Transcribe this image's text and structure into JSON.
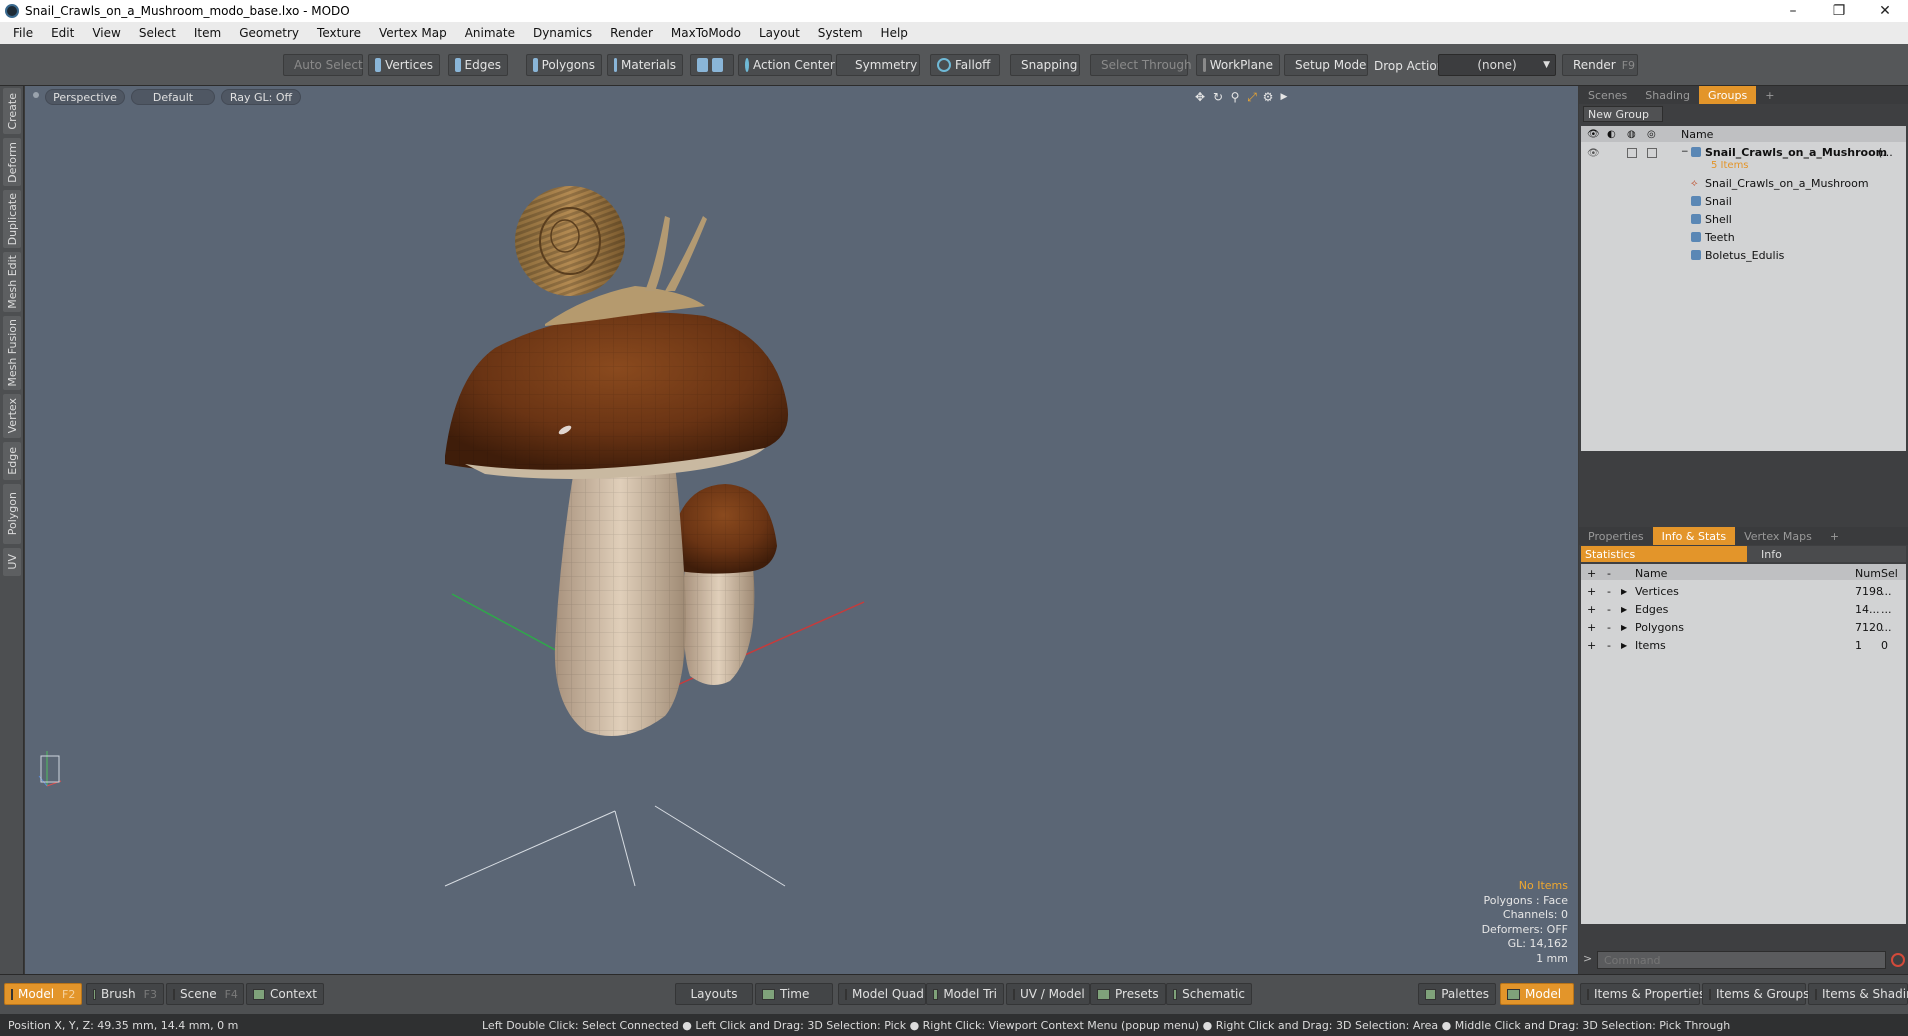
{
  "window": {
    "title": "Snail_Crawls_on_a_Mushroom_modo_base.lxo - MODO",
    "minimize": "–",
    "restore": "❐",
    "close": "✕"
  },
  "menu": [
    "File",
    "Edit",
    "View",
    "Select",
    "Item",
    "Geometry",
    "Texture",
    "Vertex Map",
    "Animate",
    "Dynamics",
    "Render",
    "MaxToModo",
    "Layout",
    "System",
    "Help"
  ],
  "toolbar": {
    "auto_select": "Auto Select",
    "vertices": "Vertices",
    "edges": "Edges",
    "polygons": "Polygons",
    "materials": "Materials",
    "action_center": "Action Center",
    "symmetry": "Symmetry",
    "falloff": "Falloff",
    "snapping": "Snapping",
    "select_through": "Select Through",
    "workplane": "WorkPlane",
    "setup_mode": "Setup Mode",
    "drop_action": "Drop Action",
    "drop_value": "(none)",
    "render": "Render",
    "render_key": "F9"
  },
  "left_tabs": [
    "Create",
    "Deform",
    "Duplicate",
    "Mesh Edit",
    "Mesh Fusion",
    "Vertex",
    "Edge",
    "Polygon",
    "UV"
  ],
  "viewport": {
    "view": "Perspective",
    "shading": "Default",
    "raygl": "Ray GL: Off",
    "icons": [
      "move-icon",
      "rotate-icon",
      "zoom-icon",
      "maximize-icon",
      "settings-icon",
      "arrow-right-icon"
    ],
    "info": {
      "items": "No Items",
      "polygons": "Polygons : Face",
      "channels": "Channels: 0",
      "deformers": "Deformers: OFF",
      "gl": "GL: 14,162",
      "scale": "1 mm"
    }
  },
  "scene_panel": {
    "tabs": [
      "Scenes",
      "Shading",
      "Groups"
    ],
    "active_tab": "Groups",
    "new_group": "New Group",
    "col_name": "Name",
    "group_name": "Snail_Crawls_on_a_Mushroom",
    "group_suffix": "(...",
    "group_count": "5 Items",
    "items": [
      "Snail_Crawls_on_a_Mushroom",
      "Snail",
      "Shell",
      "Teeth",
      "Boletus_Edulis"
    ]
  },
  "props_panel": {
    "tabs": [
      "Properties",
      "Info & Stats",
      "Vertex Maps"
    ],
    "active_tab": "Info & Stats",
    "subtabs": [
      "Statistics",
      "Info"
    ],
    "cols": {
      "name": "Name",
      "num": "Num",
      "sel": "Sel"
    },
    "rows": [
      {
        "name": "Vertices",
        "num": "7198",
        "sel": "..."
      },
      {
        "name": "Edges",
        "num": "14...",
        "sel": "..."
      },
      {
        "name": "Polygons",
        "num": "7120",
        "sel": "..."
      },
      {
        "name": "Items",
        "num": "1",
        "sel": "0"
      }
    ],
    "command_placeholder": "Command"
  },
  "bottom": {
    "model": "Model",
    "model_key": "F2",
    "brush": "Brush",
    "brush_key": "F3",
    "scene": "Scene",
    "scene_key": "F4",
    "context": "Context",
    "layouts": "Layouts",
    "time": "Time",
    "model_quad": "Model Quad",
    "model_tri": "Model Tri",
    "uv_model": "UV / Model",
    "presets": "Presets",
    "schematic": "Schematic",
    "palettes": "Palettes",
    "model2": "Model",
    "items_props": "Items & Properties",
    "items_groups": "Items & Groups",
    "items_shading": "Items & Shading"
  },
  "status": {
    "position": "Position X, Y, Z:  49.35 mm, 14.4 mm, 0 m",
    "hint": "Left Double Click: Select Connected ● Left Click and Drag: 3D Selection: Pick ● Right Click: Viewport Context Menu (popup menu) ● Right Click and Drag: 3D Selection: Area ● Middle Click and Drag: 3D Selection: Pick Through"
  },
  "colors": {
    "accent": "#e3952a",
    "viewport_bg": "#5b6675",
    "highlight_text": "#f0a830"
  }
}
